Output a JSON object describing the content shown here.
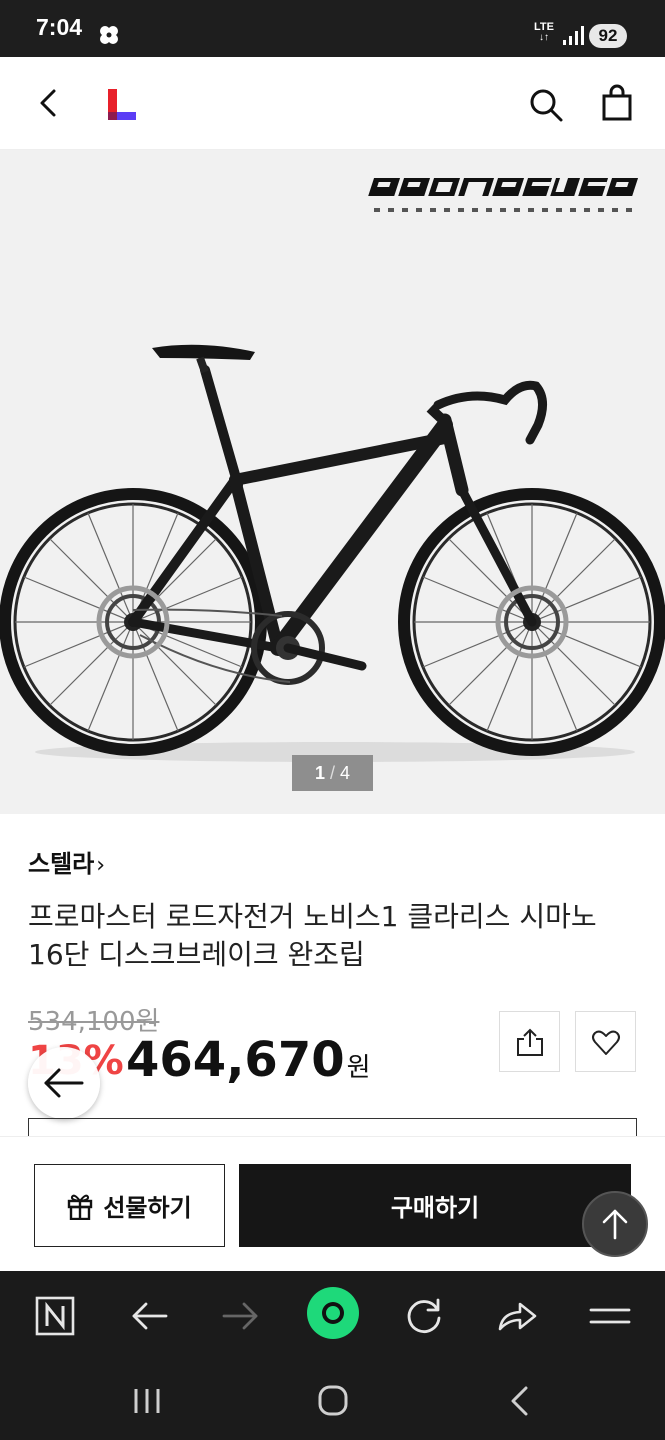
{
  "status_bar": {
    "time": "7:04",
    "network": "LTE",
    "battery": "92",
    "icons": [
      "clover-icon",
      "signal-icon"
    ]
  },
  "header": {
    "icons": [
      "back-arrow-icon",
      "lotteon-logo-icon",
      "search-icon",
      "shopping-bag-icon"
    ]
  },
  "gallery": {
    "current": "1",
    "separator": "/",
    "total": "4"
  },
  "product": {
    "seller": "스텔라",
    "seller_chevron": "›",
    "title": "프로마스터 로드자전거 노비스1 클라리스 시마노16단 디스크브레이크 완조립",
    "original_price": "534,100원",
    "discount": "13%",
    "price": "464,670",
    "currency": "원"
  },
  "actions": {
    "gift_label": "선물하기",
    "buy_label": "구매하기",
    "icons": [
      "share-icon",
      "heart-icon",
      "gift-icon",
      "arrow-up-icon",
      "arrow-left-icon"
    ]
  },
  "browser_toolbar": {
    "icons": [
      "naver-n-icon",
      "back-arrow-icon",
      "forward-arrow-icon",
      "green-dot-icon",
      "refresh-icon",
      "share-arrow-icon",
      "menu-icon"
    ]
  },
  "android_nav": {
    "icons": [
      "recents-icon",
      "home-icon",
      "back-icon"
    ]
  },
  "colors": {
    "discount": "#ef4444",
    "buy_button": "#161616",
    "accent_green": "#1ed97a"
  }
}
